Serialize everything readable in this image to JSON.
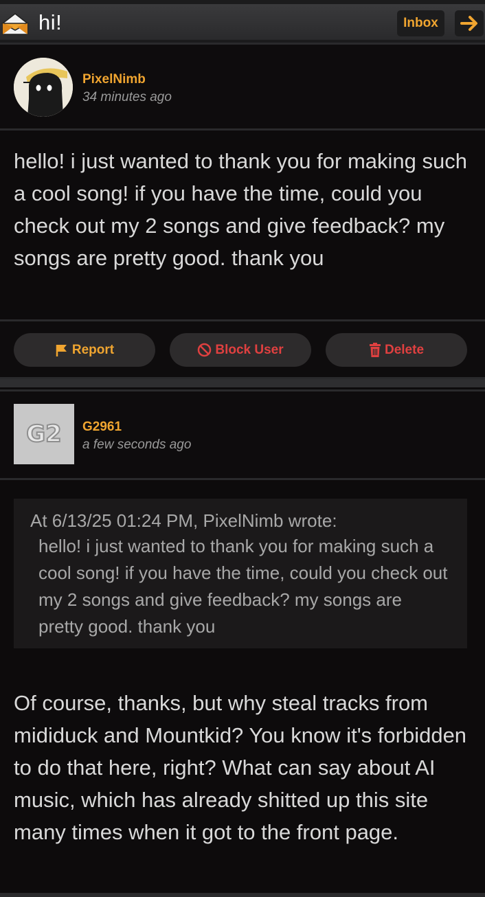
{
  "header": {
    "title": "hi!",
    "inbox_label": "Inbox",
    "icons": [
      "envelope-open-icon",
      "arrow-right-icon"
    ]
  },
  "message": {
    "author": "PixelNimb",
    "time": "34 minutes ago",
    "text": "hello! i just wanted to thank you for making such a cool song! if you have the time, could you check out my 2 songs and give feedback? my songs are pretty good. thank you"
  },
  "actions": {
    "report_label": "Report",
    "block_label": "Block User",
    "delete_label": "Delete",
    "icons": [
      "flag-icon",
      "ban-icon",
      "trash-icon"
    ]
  },
  "reply": {
    "author": "G2961",
    "time": "a few seconds ago",
    "avatar_text": "G2",
    "quote_header": "At 6/13/25 01:24 PM, PixelNimb wrote:",
    "quote_text": "hello! i just wanted to thank you for making such a cool song! if you have the time, could you check out my 2 songs and give feedback? my songs are pretty good. thank you",
    "text": "Of course, thanks, but why steal tracks from mididuck and Mountkid? You know it's forbidden to do that here, right? What can say about AI music, which has already shitted up this site many times when it got to the front page."
  },
  "colors": {
    "accent": "#f0a530",
    "danger": "#e04040",
    "background": "#0d0b0c",
    "button_bg": "#2d2b2c"
  }
}
